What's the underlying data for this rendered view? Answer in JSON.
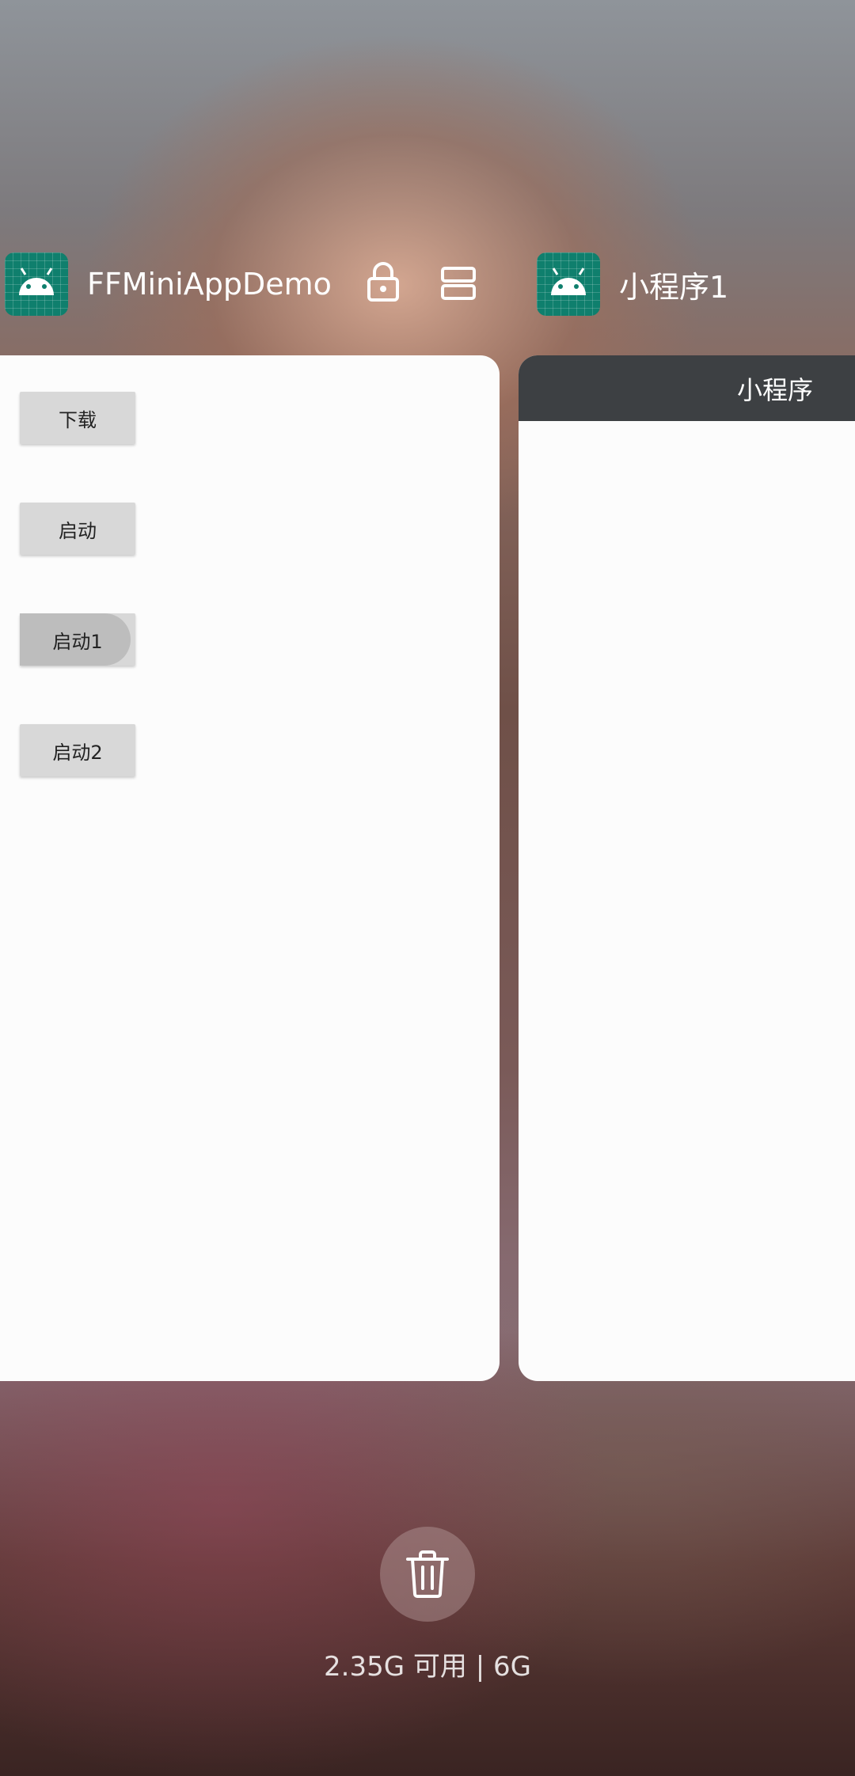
{
  "recents": {
    "apps": [
      {
        "name": "FFMiniAppDemo",
        "icon": "android-icon"
      },
      {
        "name": "小程序1",
        "icon": "android-icon"
      }
    ],
    "left_card": {
      "buttons": [
        "下载",
        "启动",
        "启动1",
        "启动2"
      ]
    },
    "right_card": {
      "title": "小程序"
    },
    "memory_text": "2.35G 可用 | 6G"
  },
  "colors": {
    "icon_bg": "#0f7f6d",
    "titlebar": "#3d4043",
    "button_bg": "#d8d8d8"
  }
}
